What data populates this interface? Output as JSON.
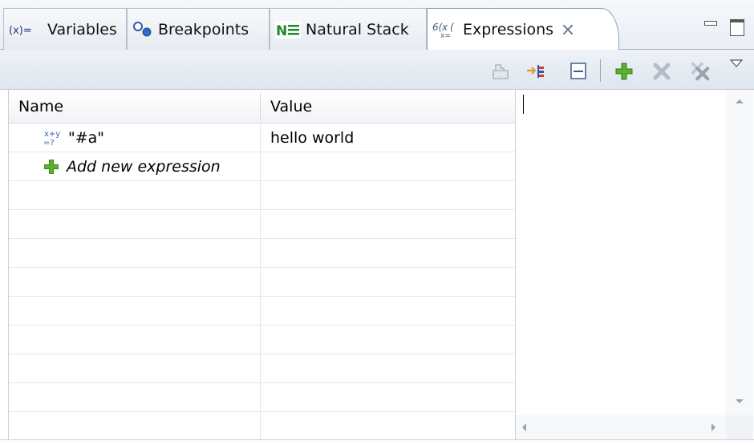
{
  "tabs": [
    {
      "label": "Variables",
      "icon": "variables-icon"
    },
    {
      "label": "Breakpoints",
      "icon": "breakpoints-icon"
    },
    {
      "label": "Natural Stack",
      "icon": "natural-stack-icon"
    },
    {
      "label": "Expressions",
      "icon": "expressions-icon",
      "active": true
    }
  ],
  "window_controls": {
    "minimize": "minimize-icon",
    "maximize": "maximize-icon"
  },
  "toolbar": {
    "buttons": [
      {
        "name": "show-type-names-button",
        "icon": "type-names-icon",
        "enabled": false
      },
      {
        "name": "show-logical-structure-button",
        "icon": "logical-structure-icon",
        "enabled": true
      },
      {
        "name": "collapse-all-button",
        "icon": "collapse-all-icon",
        "enabled": true
      },
      {
        "name": "add-watch-expression-button",
        "icon": "plus-icon",
        "enabled": true
      },
      {
        "name": "remove-expression-button",
        "icon": "remove-icon",
        "enabled": false
      },
      {
        "name": "remove-all-expressions-button",
        "icon": "remove-all-icon",
        "enabled": false
      },
      {
        "name": "view-menu-button",
        "icon": "view-menu-icon",
        "enabled": true
      }
    ]
  },
  "table": {
    "columns": {
      "name": "Name",
      "value": "Value"
    },
    "rows": [
      {
        "name": "\"#a\"",
        "value": "hello world",
        "icon": "watch-expression-icon"
      },
      {
        "name": "Add new expression",
        "value": "",
        "icon": "add-expression-icon",
        "italic": true
      }
    ]
  },
  "colors": {
    "add_green": "#4fa321",
    "remove_gray": "#b5bcc5",
    "border": "#a6b3c4"
  }
}
